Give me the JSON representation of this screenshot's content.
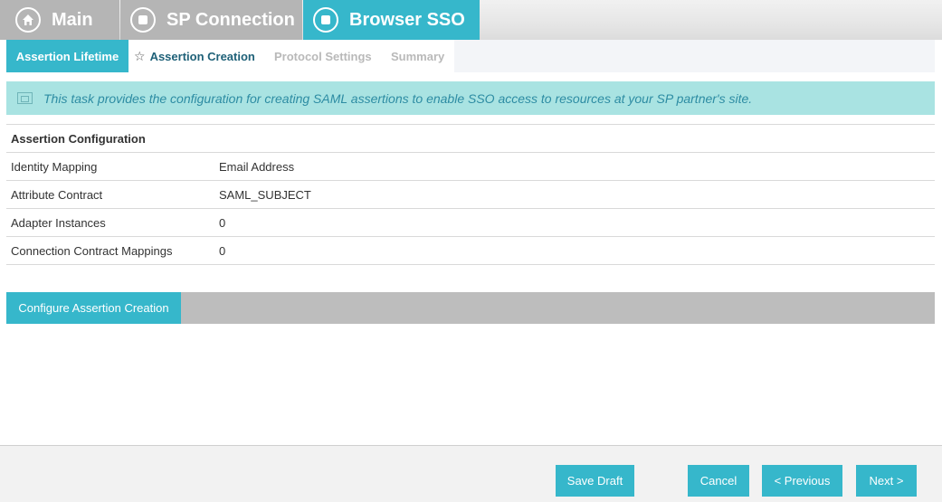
{
  "breadcrumb": {
    "main": {
      "label": "Main",
      "icon": "home-icon"
    },
    "sp_connection": {
      "label": "SP Connection",
      "icon": "square-stop-icon"
    },
    "browser_sso": {
      "label": "Browser SSO",
      "icon": "square-stop-icon"
    }
  },
  "tabs": [
    {
      "label": "Assertion Lifetime",
      "state": "active-filled"
    },
    {
      "label": "Assertion Creation",
      "state": "current",
      "icon": "star-icon"
    },
    {
      "label": "Protocol Settings",
      "state": "disabled"
    },
    {
      "label": "Summary",
      "state": "disabled"
    }
  ],
  "banner": {
    "icon": "info-window-icon",
    "text": "This task provides the configuration for creating SAML assertions to enable SSO access to resources at your SP partner's site."
  },
  "assertion_config": {
    "title": "Assertion Configuration",
    "rows": [
      {
        "label": "Identity Mapping",
        "value": "Email Address"
      },
      {
        "label": "Attribute Contract",
        "value": "SAML_SUBJECT"
      },
      {
        "label": "Adapter Instances",
        "value": "0"
      },
      {
        "label": "Connection Contract Mappings",
        "value": "0"
      }
    ]
  },
  "configure_button": {
    "label": "Configure Assertion Creation"
  },
  "footer": {
    "save_draft": "Save Draft",
    "cancel": "Cancel",
    "previous": "< Previous",
    "next": "Next >"
  },
  "colors": {
    "accent": "#36b7cb",
    "crumb_inactive": "#b5b5b5",
    "banner_bg": "#a9e3e2",
    "banner_text": "#2d8ca3"
  }
}
